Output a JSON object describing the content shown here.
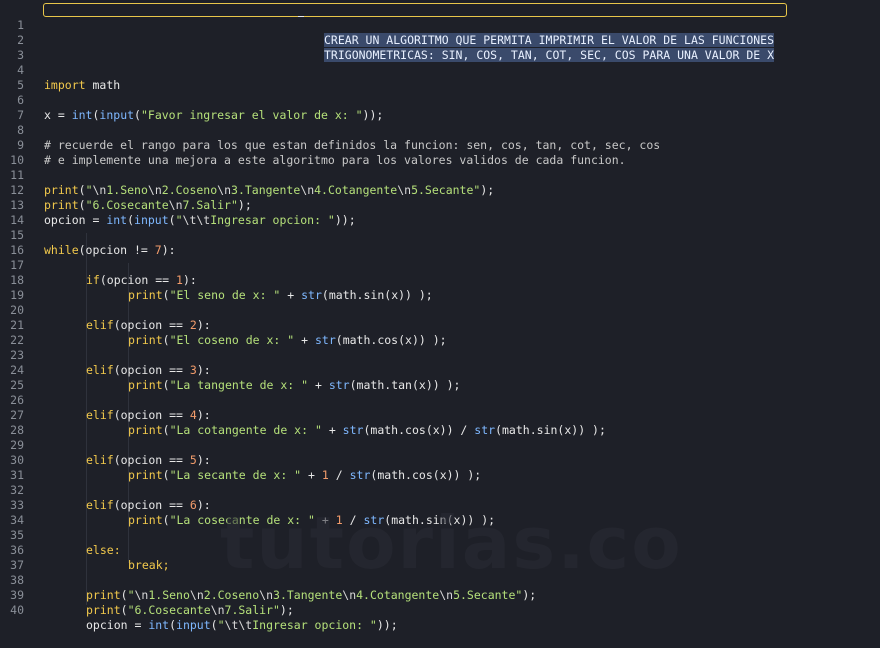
{
  "header_comment": {
    "line1": "CREAR UN ALGORITMO QUE PERMITA IMPRIMIR EL VALOR DE LAS FUNCIONES",
    "line2": "TRIGONOMETRICAS: SIN, COS, TAN, COT, SEC, COS PARA UNA VALOR DE X"
  },
  "line_numbers": [
    "1",
    "2",
    "3",
    "4",
    "5",
    "6",
    "7",
    "8",
    "9",
    "10",
    "11",
    "12",
    "13",
    "14",
    "15",
    "16",
    "17",
    "18",
    "19",
    "20",
    "21",
    "22",
    "23",
    "24",
    "25",
    "26",
    "27",
    "28",
    "29",
    "30",
    "31",
    "32",
    "33",
    "34",
    "35",
    "36",
    "37",
    "38",
    "39",
    "40"
  ],
  "code": {
    "import_kw": "import",
    "import_mod": " math",
    "x_assign": "x = ",
    "int": "int",
    "input": "input",
    "prompt_x": "\"Favor ingresar el valor de x: \"",
    "close_paren2": "));",
    "comment1": "# recuerde el rango para los que estan definidos la funcion: sen, cos, tan, cot, sec, cos",
    "comment2": "# e implemente una mejora a este algoritmo para los valores validos de cada funcion.",
    "print": "print",
    "menu1_a": "\"",
    "esc_n": "\\n",
    "menu_seno": "1.Seno",
    "menu_coseno": "2.Coseno",
    "menu_tangente": "3.Tangente",
    "menu_cotangente": "4.Cotangente",
    "menu_secante": "5.Secante\"",
    "menu_cosecante": "\"6.Cosecante",
    "menu_salir": "7.Salir\"",
    "opcion_assign": "opcion = ",
    "esc_t": "\\t\\t",
    "prompt_opcion": "Ingresar opcion: \"",
    "while_kw": "while",
    "while_cond": "(opcion != ",
    "seven": "7",
    "while_end": "):",
    "if_kw": "if",
    "elif_kw": "elif",
    "else_kw": "else:",
    "break_kw": "break;",
    "str_fn": "str",
    "math": "math",
    "sin": "sin",
    "cos": "cos",
    "tan": "tan",
    "msg_seno": "\"El seno de x: \"",
    "msg_coseno": "\"El coseno de x: \"",
    "msg_tangente": "\"La tangente de x: \"",
    "msg_cotangente": "\"La cotangente de x: \"",
    "msg_secante": "\"La secante de x: \"",
    "msg_cosecante": "\"La cosecante de x: \""
  },
  "watermark": "tutorias.co"
}
